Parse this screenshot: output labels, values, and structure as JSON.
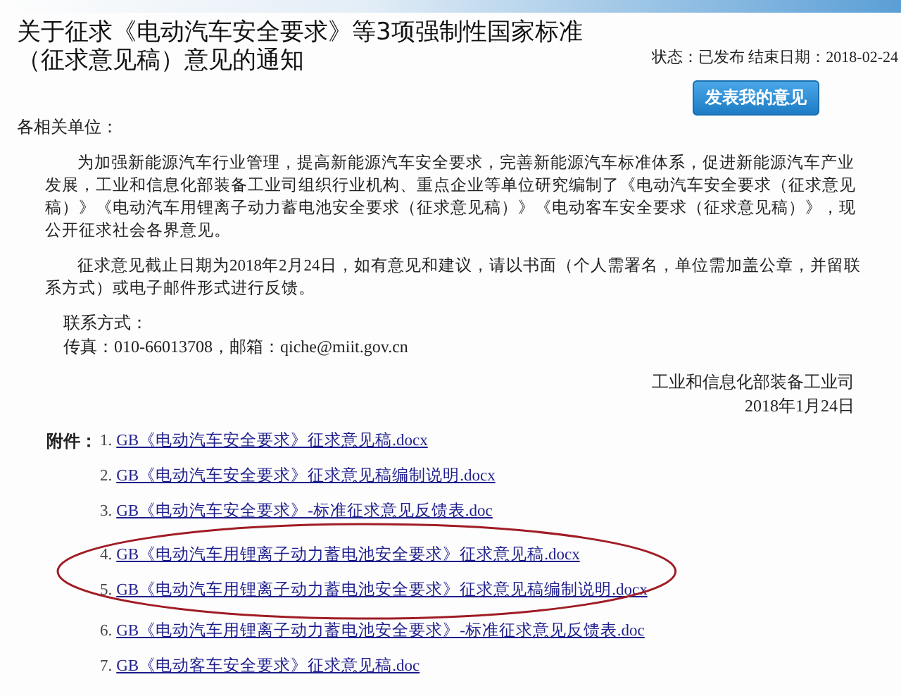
{
  "title": "关于征求《电动汽车安全要求》等3项强制性国家标准（征求意见稿）意见的通知",
  "status": {
    "status_label": "状态：",
    "status_value": "已发布",
    "end_label": "结束日期：",
    "end_value": "2018-02-24"
  },
  "comment_button": "发表我的意见",
  "salutation": "各相关单位：",
  "paragraphs": [
    "为加强新能源汽车行业管理，提高新能源汽车安全要求，完善新能源汽车标准体系，促进新能源汽车产业发展，工业和信息化部装备工业司组织行业机构、重点企业等单位研究编制了《电动汽车安全要求（征求意见稿）》《电动汽车用锂离子动力蓄电池安全要求（征求意见稿）》《电动客车安全要求（征求意见稿）》，现公开征求社会各界意见。",
    "征求意见截止日期为2018年2月24日，如有意见和建议，请以书面（个人需署名，单位需加盖公章，并留联系方式）或电子邮件形式进行反馈。"
  ],
  "contact": {
    "heading": "联系方式：",
    "line": "传真：010-66013708，邮箱：qiche@miit.gov.cn"
  },
  "signature": {
    "organization": "工业和信息化部装备工业司",
    "date": "2018年1月24日"
  },
  "attachments_label": "附件：",
  "attachments": [
    {
      "number": "1.",
      "title": "GB《电动汽车安全要求》征求意见稿.docx",
      "highlighted": false
    },
    {
      "number": "2.",
      "title": "GB《电动汽车安全要求》征求意见稿编制说明.docx",
      "highlighted": false
    },
    {
      "number": "3.",
      "title": "GB《电动汽车安全要求》-标准征求意见反馈表.doc",
      "highlighted": false
    },
    {
      "number": "4.",
      "title": "GB《电动汽车用锂离子动力蓄电池安全要求》征求意见稿.docx",
      "highlighted": true
    },
    {
      "number": "5.",
      "title": "GB《电动汽车用锂离子动力蓄电池安全要求》征求意见稿编制说明.docx",
      "highlighted": true
    },
    {
      "number": "6.",
      "title": "GB《电动汽车用锂离子动力蓄电池安全要求》-标准征求意见反馈表.doc",
      "highlighted": false
    },
    {
      "number": "7.",
      "title": "GB《电动客车安全要求》征求意见稿.doc",
      "highlighted": false
    }
  ]
}
